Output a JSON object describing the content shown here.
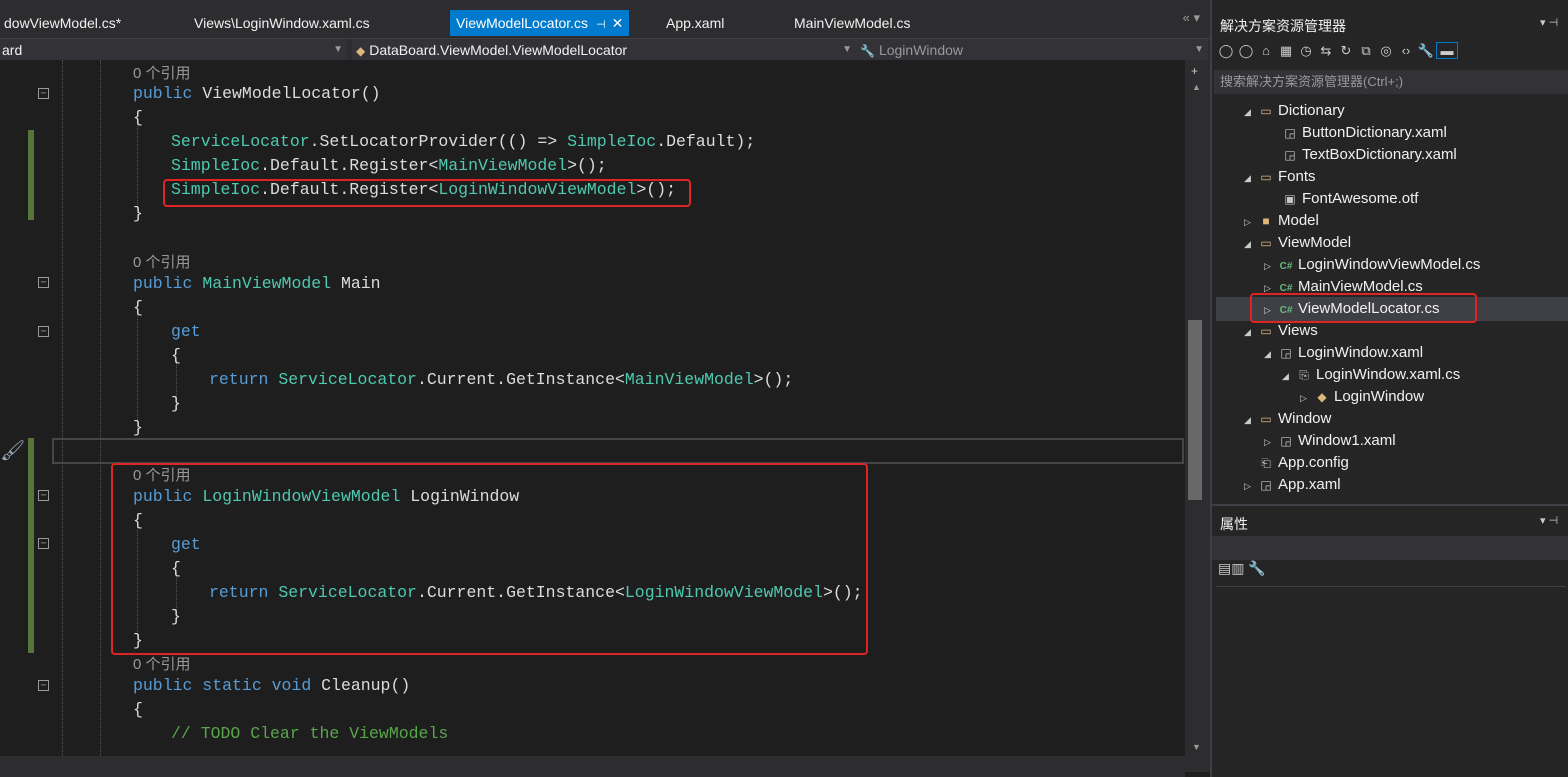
{
  "tabs": [
    {
      "label": "dowViewModel.cs*"
    },
    {
      "label": "Views\\LoginWindow.xaml.cs"
    },
    {
      "label": "ViewModelLocator.cs"
    },
    {
      "label": "App.xaml"
    },
    {
      "label": "MainViewModel.cs"
    }
  ],
  "tab_overflow": "« ▾",
  "nav": {
    "project": "ard",
    "class": "DataBoard.ViewModel.ViewModelLocator",
    "member": "LoginWindow"
  },
  "code": {
    "ref_label": "0 个引用",
    "ctor_sig_kw": "public",
    "ctor_sig_name": "ViewModelLocator()",
    "brace_open": "{",
    "brace_close": "}",
    "l1_a": "ServiceLocator",
    "l1_b": ".SetLocatorProvider(() => ",
    "l1_c": "SimpleIoc",
    "l1_d": ".Default);",
    "l2_a": "SimpleIoc",
    "l2_b": ".Default.Register<",
    "l2_c": "MainViewModel",
    "l2_d": ">();",
    "l3_a": "SimpleIoc",
    "l3_b": ".Default.Register<",
    "l3_c": "LoginWindowViewModel",
    "l3_d": ">();",
    "main_type": "MainViewModel",
    "main_name": " Main",
    "get_kw": "get",
    "return_kw": "return",
    "ret1_b": ".Current.GetInstance<",
    "ret1_d": ">();",
    "login_type": "LoginWindowViewModel",
    "login_name": " LoginWindow",
    "cleanup_kw": "public static void",
    "cleanup_name": " Cleanup()",
    "comment": "// TODO Clear the ViewModels"
  },
  "solution_explorer": {
    "title": "解决方案资源管理器",
    "search_placeholder": "搜索解决方案资源管理器(Ctrl+;)",
    "items": [
      {
        "label": "Dictionary"
      },
      {
        "label": "ButtonDictionary.xaml"
      },
      {
        "label": "TextBoxDictionary.xaml"
      },
      {
        "label": "Fonts"
      },
      {
        "label": "FontAwesome.otf"
      },
      {
        "label": "Model"
      },
      {
        "label": "ViewModel"
      },
      {
        "label": "LoginWindowViewModel.cs"
      },
      {
        "label": "MainViewModel.cs"
      },
      {
        "label": "ViewModelLocator.cs"
      },
      {
        "label": "Views"
      },
      {
        "label": "LoginWindow.xaml"
      },
      {
        "label": "LoginWindow.xaml.cs"
      },
      {
        "label": "LoginWindow"
      },
      {
        "label": "Window"
      },
      {
        "label": "Window1.xaml"
      },
      {
        "label": "App.config"
      },
      {
        "label": "App.xaml"
      }
    ]
  },
  "properties": {
    "title": "属性"
  },
  "colors": {
    "accent": "#007acc",
    "highlight_box": "#e02424",
    "keyword": "#569cd6",
    "type": "#4ec9b0",
    "comment": "#57a64a"
  }
}
